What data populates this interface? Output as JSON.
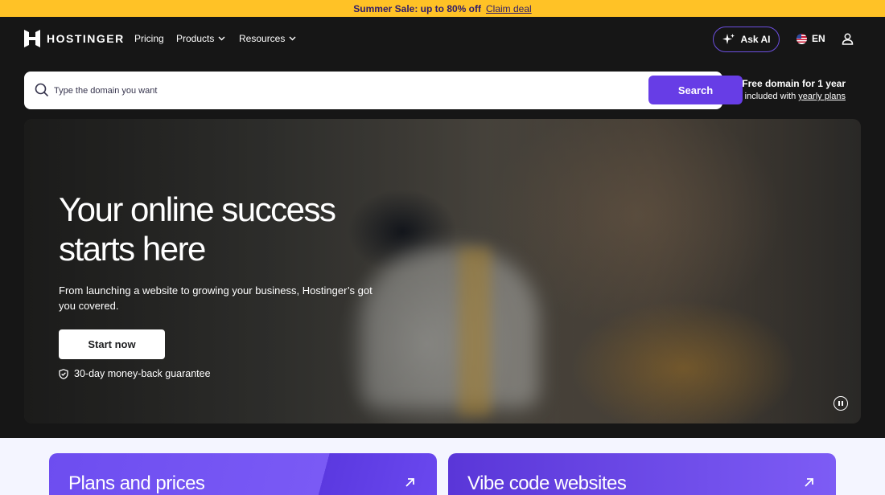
{
  "promo": {
    "text": "Summer Sale: up to 80% off",
    "link": "Claim deal"
  },
  "nav": {
    "brand": "HOSTINGER",
    "links": [
      "Pricing",
      "Products",
      "Resources"
    ],
    "ask_ai": "Ask AI",
    "language": "EN"
  },
  "search": {
    "placeholder": "Type the domain you want",
    "button": "Search"
  },
  "domain_promo": {
    "title": "Free domain for 1 year",
    "sub_prefix": "included with",
    "sub_link": "yearly plans"
  },
  "hero": {
    "title": "Your online success starts here",
    "subtitle": "From launching a website to growing your business, Hostinger’s got you covered.",
    "cta": "Start now",
    "guarantee": "30-day money-back guarantee"
  },
  "cards": [
    {
      "title": "Plans and prices"
    },
    {
      "title": "Vibe code websites"
    }
  ],
  "colors": {
    "accent": "#673de6",
    "promo_bg": "#ffc226",
    "background": "#161616"
  },
  "icons": [
    "hostinger-logo-icon",
    "chevron-down-icon",
    "sparkle-icon",
    "us-flag-icon",
    "user-icon",
    "search-icon",
    "shield-check-icon",
    "pause-icon",
    "arrow-up-right-icon"
  ]
}
